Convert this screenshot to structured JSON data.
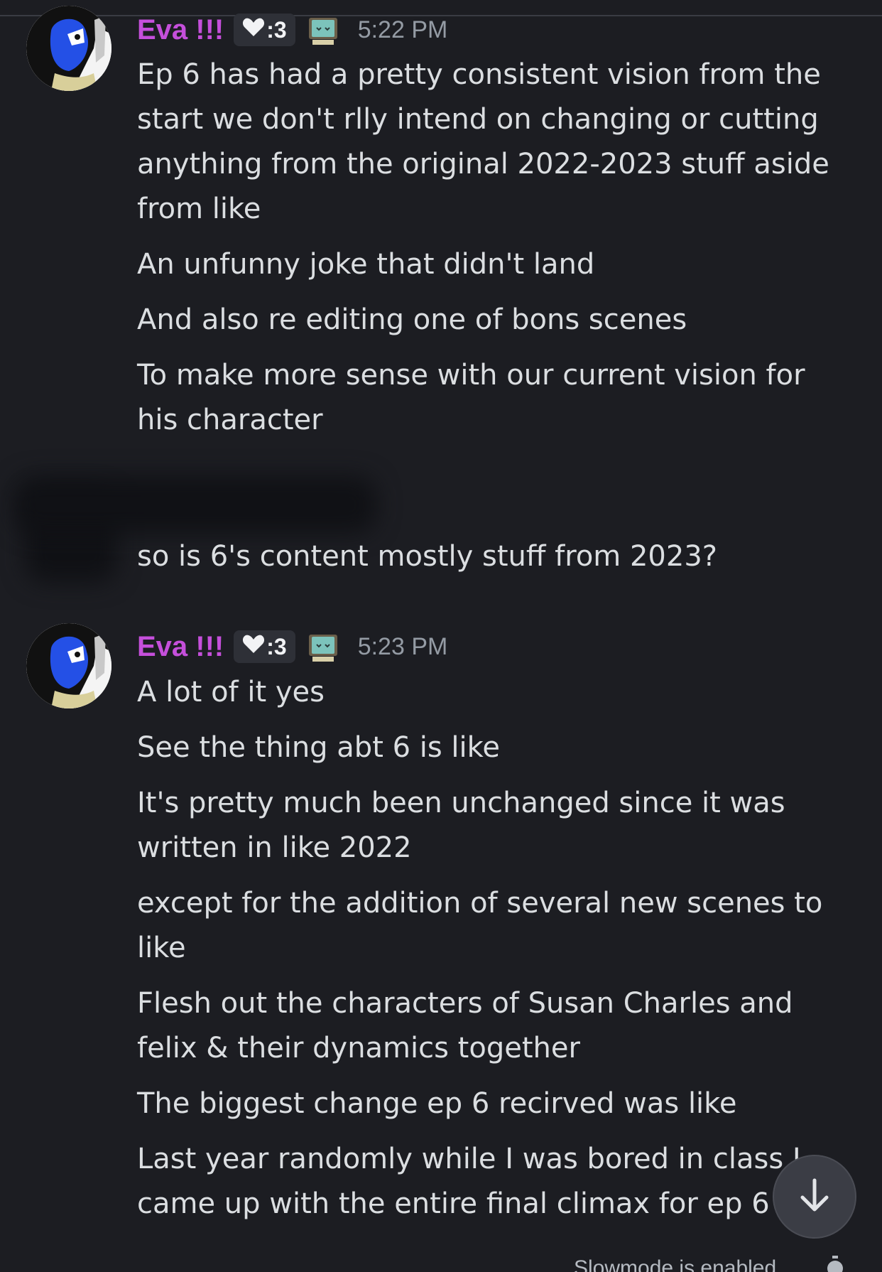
{
  "messages_group_1": {
    "author": "Eva !!!",
    "tag": ":3",
    "timestamp": "5:22 PM",
    "lines": [
      "Ep 6 has had a pretty consistent vision from the start we don't rlly intend on changing or cutting anything from the original 2022-2023 stuff aside from like",
      "An unfunny joke that didn't land",
      "And also re editing one of bons scenes",
      "To make more sense with our current vision for his character"
    ]
  },
  "redacted_message": {
    "text": "so is 6's content mostly stuff from 2023?"
  },
  "messages_group_2": {
    "author": "Eva !!!",
    "tag": ":3",
    "timestamp": "5:23 PM",
    "lines": [
      "A lot of it yes",
      "See the thing abt 6 is like",
      "It's pretty much been unchanged since it was written in like 2022",
      "except for the addition of several new scenes to like",
      "Flesh out the characters of Susan Charles and felix & their dynamics together",
      "The biggest change ep 6 recirved was like",
      "Last year randomly while I was bored in class I came up with the entire final climax for ep 6"
    ]
  },
  "footer": {
    "slowmode_text": "Slowmode is enabled"
  },
  "icons": {
    "tag_icon": "heart-icon",
    "role_icon": "tv-robot-icon",
    "scroll_icon": "arrow-down-icon",
    "slowmode_icon": "timer-icon"
  },
  "colors": {
    "background": "#1c1d22",
    "username": "#c54fdb",
    "text": "#dbdee1",
    "timestamp": "#949ba4"
  }
}
